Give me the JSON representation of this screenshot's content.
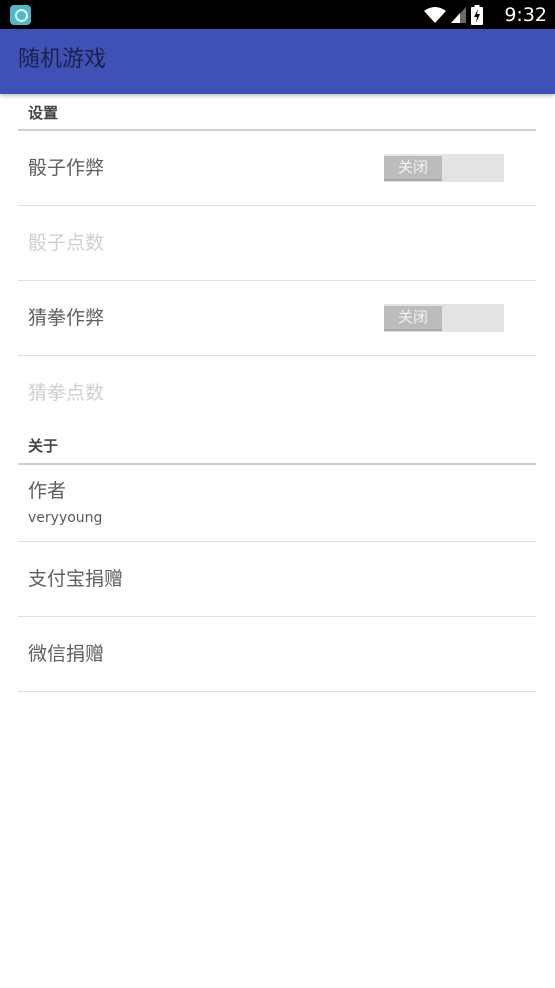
{
  "status_bar": {
    "time": "9:32",
    "icons": [
      "app-notification-icon",
      "wifi-icon",
      "cell-signal-icon",
      "battery-charging-icon"
    ]
  },
  "toolbar": {
    "title": "随机游戏",
    "background_color": "#3f51b5"
  },
  "settings": {
    "section_title": "设置",
    "items": [
      {
        "title": "骰子作弊",
        "toggle_label": "关闭",
        "enabled": true,
        "checked": false
      },
      {
        "title": "骰子点数",
        "enabled": false
      },
      {
        "title": "猜拳作弊",
        "toggle_label": "关闭",
        "enabled": true,
        "checked": false
      },
      {
        "title": "猜拳点数",
        "enabled": false
      }
    ]
  },
  "about": {
    "section_title": "关于",
    "items": [
      {
        "title": "作者",
        "summary": "veryyoung"
      },
      {
        "title": "支付宝捐赠"
      },
      {
        "title": "微信捐赠"
      }
    ]
  }
}
